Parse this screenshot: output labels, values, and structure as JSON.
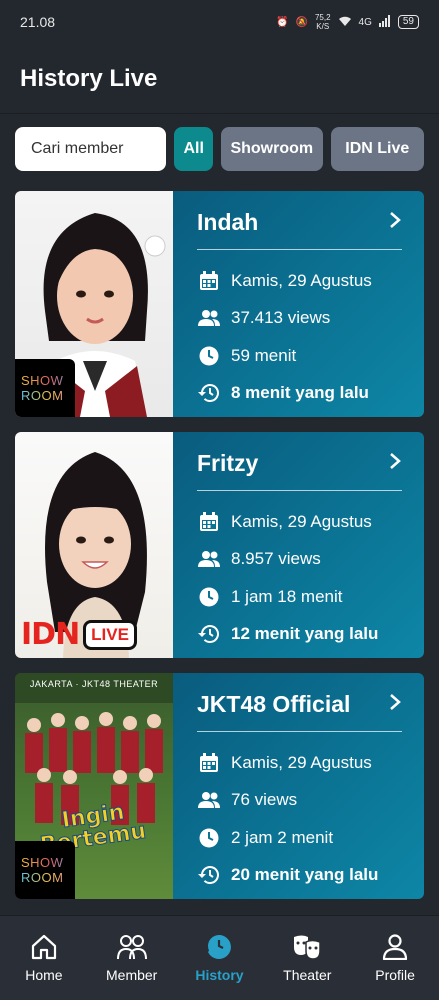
{
  "status": {
    "time": "21.08",
    "speed": "75,2\nK/S",
    "network": "4G",
    "battery": "59"
  },
  "header": {
    "title": "History Live"
  },
  "filters": {
    "search_placeholder": "Cari member",
    "all": "All",
    "showroom": "Showroom",
    "idn": "IDN Live"
  },
  "cards": [
    {
      "name": "Indah",
      "date": "Kamis, 29 Agustus",
      "views": "37.413 views",
      "duration": "59 menit",
      "ago": "8 menit yang lalu",
      "platform": "showroom"
    },
    {
      "name": "Fritzy",
      "date": "Kamis, 29 Agustus",
      "views": "8.957 views",
      "duration": "1 jam 18 menit",
      "ago": "12 menit yang lalu",
      "platform": "idn"
    },
    {
      "name": "JKT48 Official",
      "date": "Kamis, 29 Agustus",
      "views": "76 views",
      "duration": "2 jam 2 menit",
      "ago": "20 menit yang lalu",
      "platform": "showroom",
      "poster_title": "Ingin Bertemu",
      "poster_header": "JAKARTA · JKT48 THEATER"
    }
  ],
  "badges": {
    "sr_line1": "SHOW",
    "sr_line2": "ROOM",
    "idn": "IDN",
    "live": "LIVE"
  },
  "nav": [
    {
      "label": "Home",
      "icon": "home-icon"
    },
    {
      "label": "Member",
      "icon": "members-icon"
    },
    {
      "label": "History",
      "icon": "history-icon"
    },
    {
      "label": "Theater",
      "icon": "theater-icon"
    },
    {
      "label": "Profile",
      "icon": "profile-icon"
    }
  ],
  "colors": {
    "accent": "#28a0c8",
    "card": "#0b7394",
    "all_chip": "#0d8a8e"
  }
}
